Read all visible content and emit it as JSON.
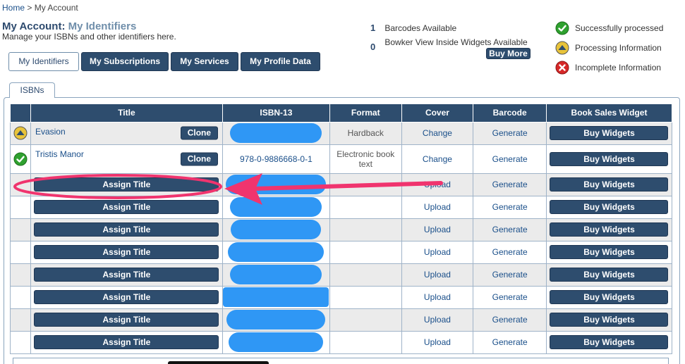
{
  "breadcrumb": {
    "home": "Home",
    "separator": " > ",
    "current": "My Account"
  },
  "page": {
    "title_prefix": "My Account:",
    "title_accent": "My Identifiers",
    "subtitle": "Manage your ISBNs and other identifiers here."
  },
  "availability": {
    "barcodes_count": "1",
    "barcodes_label": "Barcodes Available",
    "widgets_count": "0",
    "widgets_label": "Bowker View Inside Widgets Available",
    "buy_more_label": "Buy More"
  },
  "legend": [
    {
      "icon": "check-circle-icon",
      "label": "Successfully processed",
      "color": "#2fa12f"
    },
    {
      "icon": "processing-triangle-icon",
      "label": "Processing Information",
      "color": "#e8c33a"
    },
    {
      "icon": "x-circle-icon",
      "label": "Incomplete Information",
      "color": "#d62828"
    }
  ],
  "tabs": [
    {
      "label": "My Identifiers",
      "active": true
    },
    {
      "label": "My Subscriptions",
      "active": false
    },
    {
      "label": "My Services",
      "active": false
    },
    {
      "label": "My Profile Data",
      "active": false
    }
  ],
  "subtab": {
    "label": "ISBNs"
  },
  "table": {
    "columns": [
      "Title",
      "ISBN-13",
      "Format",
      "Cover",
      "Barcode",
      "Book Sales Widget"
    ],
    "clone_label": "Clone",
    "assign_label": "Assign Title",
    "buy_label": "Buy Widgets",
    "rows": [
      {
        "status": "processing",
        "title": "Evasion",
        "isbn": "",
        "format": "Hardback",
        "cover": "Change",
        "barcode": "Generate"
      },
      {
        "status": "success",
        "title": "Tristis Manor",
        "isbn": "978-0-9886668-0-1",
        "format": "Electronic book text",
        "cover": "Change",
        "barcode": "Generate"
      },
      {
        "status": "",
        "title": "",
        "isbn": "",
        "format": "",
        "cover": "Upload",
        "barcode": "Generate"
      },
      {
        "status": "",
        "title": "",
        "isbn": "",
        "format": "",
        "cover": "Upload",
        "barcode": "Generate"
      },
      {
        "status": "",
        "title": "",
        "isbn": "",
        "format": "",
        "cover": "Upload",
        "barcode": "Generate"
      },
      {
        "status": "",
        "title": "",
        "isbn": "",
        "format": "",
        "cover": "Upload",
        "barcode": "Generate"
      },
      {
        "status": "",
        "title": "",
        "isbn": "",
        "format": "",
        "cover": "Upload",
        "barcode": "Generate"
      },
      {
        "status": "",
        "title": "",
        "isbn": "",
        "format": "",
        "cover": "Upload",
        "barcode": "Generate"
      },
      {
        "status": "",
        "title": "",
        "isbn": "",
        "format": "",
        "cover": "Upload",
        "barcode": "Generate"
      },
      {
        "status": "",
        "title": "",
        "isbn": "",
        "format": "",
        "cover": "Upload",
        "barcode": "Generate"
      }
    ]
  },
  "annotation": {
    "color": "#f0346e",
    "redaction_color": "#2f97f5"
  }
}
